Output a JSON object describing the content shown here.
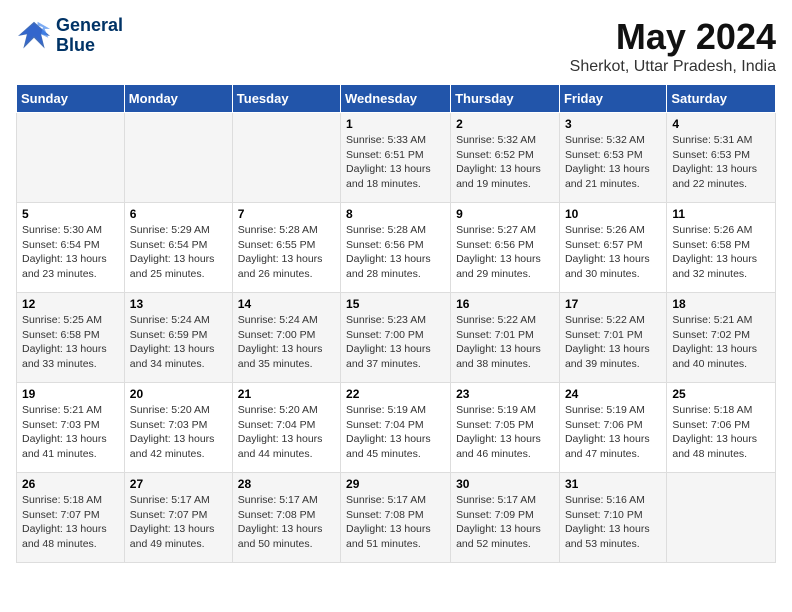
{
  "header": {
    "logo_line1": "General",
    "logo_line2": "Blue",
    "month": "May 2024",
    "location": "Sherkot, Uttar Pradesh, India"
  },
  "weekdays": [
    "Sunday",
    "Monday",
    "Tuesday",
    "Wednesday",
    "Thursday",
    "Friday",
    "Saturday"
  ],
  "weeks": [
    [
      {
        "day": "",
        "info": ""
      },
      {
        "day": "",
        "info": ""
      },
      {
        "day": "",
        "info": ""
      },
      {
        "day": "1",
        "info": "Sunrise: 5:33 AM\nSunset: 6:51 PM\nDaylight: 13 hours\nand 18 minutes."
      },
      {
        "day": "2",
        "info": "Sunrise: 5:32 AM\nSunset: 6:52 PM\nDaylight: 13 hours\nand 19 minutes."
      },
      {
        "day": "3",
        "info": "Sunrise: 5:32 AM\nSunset: 6:53 PM\nDaylight: 13 hours\nand 21 minutes."
      },
      {
        "day": "4",
        "info": "Sunrise: 5:31 AM\nSunset: 6:53 PM\nDaylight: 13 hours\nand 22 minutes."
      }
    ],
    [
      {
        "day": "5",
        "info": "Sunrise: 5:30 AM\nSunset: 6:54 PM\nDaylight: 13 hours\nand 23 minutes."
      },
      {
        "day": "6",
        "info": "Sunrise: 5:29 AM\nSunset: 6:54 PM\nDaylight: 13 hours\nand 25 minutes."
      },
      {
        "day": "7",
        "info": "Sunrise: 5:28 AM\nSunset: 6:55 PM\nDaylight: 13 hours\nand 26 minutes."
      },
      {
        "day": "8",
        "info": "Sunrise: 5:28 AM\nSunset: 6:56 PM\nDaylight: 13 hours\nand 28 minutes."
      },
      {
        "day": "9",
        "info": "Sunrise: 5:27 AM\nSunset: 6:56 PM\nDaylight: 13 hours\nand 29 minutes."
      },
      {
        "day": "10",
        "info": "Sunrise: 5:26 AM\nSunset: 6:57 PM\nDaylight: 13 hours\nand 30 minutes."
      },
      {
        "day": "11",
        "info": "Sunrise: 5:26 AM\nSunset: 6:58 PM\nDaylight: 13 hours\nand 32 minutes."
      }
    ],
    [
      {
        "day": "12",
        "info": "Sunrise: 5:25 AM\nSunset: 6:58 PM\nDaylight: 13 hours\nand 33 minutes."
      },
      {
        "day": "13",
        "info": "Sunrise: 5:24 AM\nSunset: 6:59 PM\nDaylight: 13 hours\nand 34 minutes."
      },
      {
        "day": "14",
        "info": "Sunrise: 5:24 AM\nSunset: 7:00 PM\nDaylight: 13 hours\nand 35 minutes."
      },
      {
        "day": "15",
        "info": "Sunrise: 5:23 AM\nSunset: 7:00 PM\nDaylight: 13 hours\nand 37 minutes."
      },
      {
        "day": "16",
        "info": "Sunrise: 5:22 AM\nSunset: 7:01 PM\nDaylight: 13 hours\nand 38 minutes."
      },
      {
        "day": "17",
        "info": "Sunrise: 5:22 AM\nSunset: 7:01 PM\nDaylight: 13 hours\nand 39 minutes."
      },
      {
        "day": "18",
        "info": "Sunrise: 5:21 AM\nSunset: 7:02 PM\nDaylight: 13 hours\nand 40 minutes."
      }
    ],
    [
      {
        "day": "19",
        "info": "Sunrise: 5:21 AM\nSunset: 7:03 PM\nDaylight: 13 hours\nand 41 minutes."
      },
      {
        "day": "20",
        "info": "Sunrise: 5:20 AM\nSunset: 7:03 PM\nDaylight: 13 hours\nand 42 minutes."
      },
      {
        "day": "21",
        "info": "Sunrise: 5:20 AM\nSunset: 7:04 PM\nDaylight: 13 hours\nand 44 minutes."
      },
      {
        "day": "22",
        "info": "Sunrise: 5:19 AM\nSunset: 7:04 PM\nDaylight: 13 hours\nand 45 minutes."
      },
      {
        "day": "23",
        "info": "Sunrise: 5:19 AM\nSunset: 7:05 PM\nDaylight: 13 hours\nand 46 minutes."
      },
      {
        "day": "24",
        "info": "Sunrise: 5:19 AM\nSunset: 7:06 PM\nDaylight: 13 hours\nand 47 minutes."
      },
      {
        "day": "25",
        "info": "Sunrise: 5:18 AM\nSunset: 7:06 PM\nDaylight: 13 hours\nand 48 minutes."
      }
    ],
    [
      {
        "day": "26",
        "info": "Sunrise: 5:18 AM\nSunset: 7:07 PM\nDaylight: 13 hours\nand 48 minutes."
      },
      {
        "day": "27",
        "info": "Sunrise: 5:17 AM\nSunset: 7:07 PM\nDaylight: 13 hours\nand 49 minutes."
      },
      {
        "day": "28",
        "info": "Sunrise: 5:17 AM\nSunset: 7:08 PM\nDaylight: 13 hours\nand 50 minutes."
      },
      {
        "day": "29",
        "info": "Sunrise: 5:17 AM\nSunset: 7:08 PM\nDaylight: 13 hours\nand 51 minutes."
      },
      {
        "day": "30",
        "info": "Sunrise: 5:17 AM\nSunset: 7:09 PM\nDaylight: 13 hours\nand 52 minutes."
      },
      {
        "day": "31",
        "info": "Sunrise: 5:16 AM\nSunset: 7:10 PM\nDaylight: 13 hours\nand 53 minutes."
      },
      {
        "day": "",
        "info": ""
      }
    ]
  ]
}
